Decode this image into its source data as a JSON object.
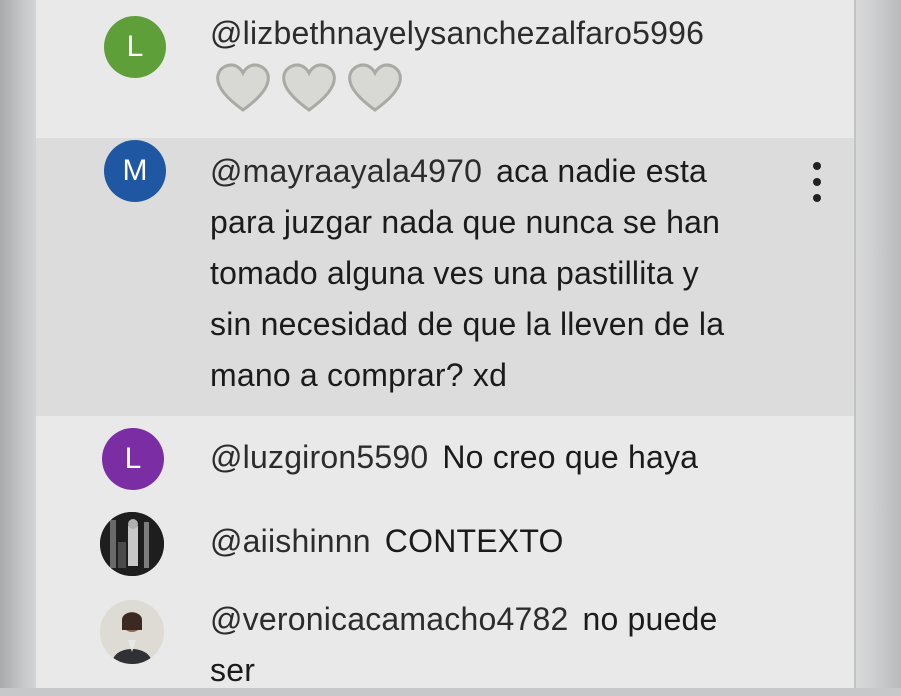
{
  "comments": [
    {
      "author": "@lizbethnayelysanchezalfaro5996",
      "avatar_letter": "L",
      "avatar_color": "#5e9f39",
      "message": "",
      "hearts": 3,
      "heart_icon": "white-heart-icon"
    },
    {
      "author": "@mayraayala4970",
      "avatar_letter": "M",
      "avatar_color": "#1f57a3",
      "message_lines": [
        "aca nadie esta",
        "para juzgar nada que nunca se han",
        "tomado alguna ves una pastillita y",
        "sin necesidad de que la lleven de la",
        "mano a comprar? xd"
      ],
      "menu_icon": "more-vert-icon",
      "highlighted": true
    },
    {
      "author": "@luzgiron5590",
      "avatar_letter": "L",
      "avatar_color": "#7b2ea3",
      "message": "No creo que haya"
    },
    {
      "author": "@aiishinnn",
      "avatar_icon": "photo-avatar",
      "message": "CONTEXTO"
    },
    {
      "author": "@veronicacamacho4782",
      "avatar_icon": "photo-avatar",
      "message_lines": [
        "no puede",
        "ser"
      ]
    }
  ]
}
